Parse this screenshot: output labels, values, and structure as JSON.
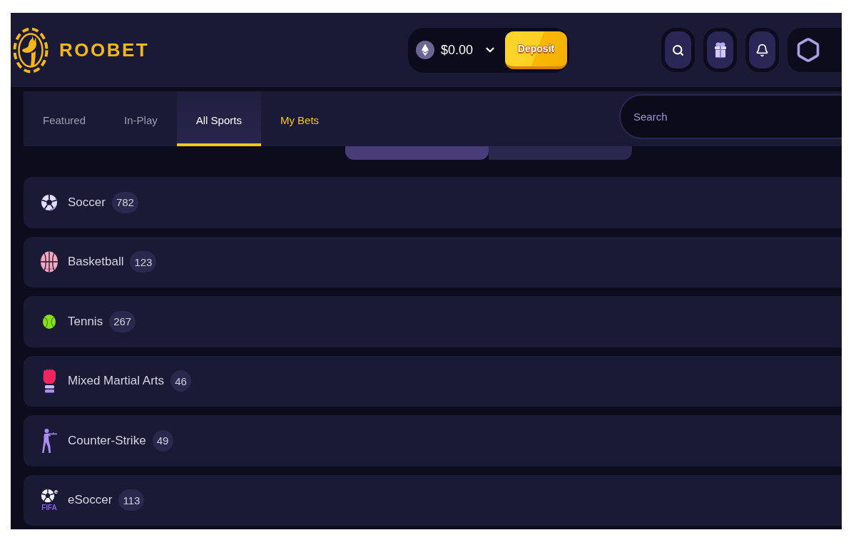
{
  "header": {
    "brand": "ROOBET",
    "wallet": {
      "balance": "$0.00",
      "deposit": "Deposit"
    }
  },
  "tabs": [
    {
      "label": "Featured",
      "selected": false,
      "accent": false
    },
    {
      "label": "In-Play",
      "selected": false,
      "accent": false
    },
    {
      "label": "All Sports",
      "selected": true,
      "accent": false
    },
    {
      "label": "My Bets",
      "selected": false,
      "accent": true
    }
  ],
  "search": {
    "placeholder": "Search"
  },
  "sort_toggle": [
    {
      "selected": true
    },
    {
      "selected": false
    }
  ],
  "sports": [
    {
      "kind": "soccer",
      "name": "Soccer",
      "count": "782"
    },
    {
      "kind": "basketball",
      "name": "Basketball",
      "count": "123"
    },
    {
      "kind": "tennis",
      "name": "Tennis",
      "count": "267"
    },
    {
      "kind": "mma",
      "name": "Mixed Martial Arts",
      "count": "46"
    },
    {
      "kind": "counter_strike",
      "name": "Counter-Strike",
      "count": "49"
    },
    {
      "kind": "esoccer",
      "name": "eSoccer",
      "count": "113",
      "logo_mark": "e",
      "logo_caption": "FIFA"
    }
  ]
}
